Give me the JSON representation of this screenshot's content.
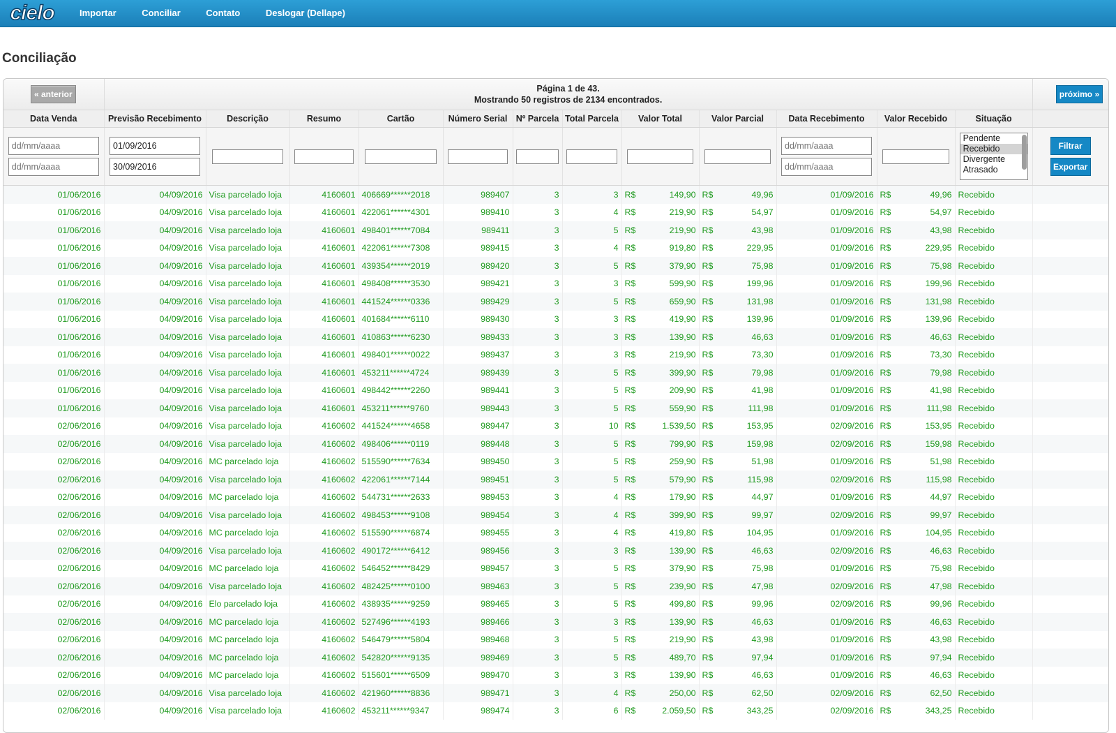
{
  "brand": {
    "logo_text": "cielo"
  },
  "nav": {
    "items": [
      "Importar",
      "Conciliar",
      "Contato",
      "Deslogar (Dellape)"
    ]
  },
  "page": {
    "title": "Conciliação"
  },
  "pager": {
    "prev_label": "« anterior",
    "next_label": "próximo »",
    "page_line": "Página 1 de 43.",
    "count_line": "Mostrando 50 registros de 2134 encontrados."
  },
  "columns": [
    "Data Venda",
    "Previsão Recebimento",
    "Descrição",
    "Resumo",
    "Cartão",
    "Número Serial",
    "Nº Parcela",
    "Total Parcela",
    "Valor Total",
    "Valor Parcial",
    "Data Recebimento",
    "Valor Recebido",
    "Situação",
    ""
  ],
  "filters": {
    "data_venda_from": {
      "value": "",
      "placeholder": "dd/mm/aaaa"
    },
    "data_venda_to": {
      "value": "",
      "placeholder": "dd/mm/aaaa"
    },
    "previsao_from": {
      "value": "01/09/2016",
      "placeholder": "dd/mm/aaaa"
    },
    "previsao_to": {
      "value": "30/09/2016",
      "placeholder": "dd/mm/aaaa"
    },
    "data_receb_from": {
      "value": "",
      "placeholder": "dd/mm/aaaa"
    },
    "data_receb_to": {
      "value": "",
      "placeholder": "dd/mm/aaaa"
    },
    "situacao_options": [
      "Pendente",
      "Recebido",
      "Divergente",
      "Atrasado"
    ],
    "situacao_selected": "Recebido",
    "filter_button": "Filtrar",
    "export_button": "Exportar"
  },
  "currency": "R$",
  "rows": [
    [
      "01/06/2016",
      "04/09/2016",
      "Visa parcelado loja",
      "4160601",
      "406669******2018",
      "989407",
      "3",
      "3",
      "149,90",
      "49,96",
      "01/09/2016",
      "49,96",
      "Recebido"
    ],
    [
      "01/06/2016",
      "04/09/2016",
      "Visa parcelado loja",
      "4160601",
      "422061******4301",
      "989410",
      "3",
      "4",
      "219,90",
      "54,97",
      "01/09/2016",
      "54,97",
      "Recebido"
    ],
    [
      "01/06/2016",
      "04/09/2016",
      "Visa parcelado loja",
      "4160601",
      "498401******7084",
      "989411",
      "3",
      "5",
      "219,90",
      "43,98",
      "01/09/2016",
      "43,98",
      "Recebido"
    ],
    [
      "01/06/2016",
      "04/09/2016",
      "Visa parcelado loja",
      "4160601",
      "422061******7308",
      "989415",
      "3",
      "4",
      "919,80",
      "229,95",
      "01/09/2016",
      "229,95",
      "Recebido"
    ],
    [
      "01/06/2016",
      "04/09/2016",
      "Visa parcelado loja",
      "4160601",
      "439354******2019",
      "989420",
      "3",
      "5",
      "379,90",
      "75,98",
      "01/09/2016",
      "75,98",
      "Recebido"
    ],
    [
      "01/06/2016",
      "04/09/2016",
      "Visa parcelado loja",
      "4160601",
      "498408******3530",
      "989421",
      "3",
      "3",
      "599,90",
      "199,96",
      "01/09/2016",
      "199,96",
      "Recebido"
    ],
    [
      "01/06/2016",
      "04/09/2016",
      "Visa parcelado loja",
      "4160601",
      "441524******0336",
      "989429",
      "3",
      "5",
      "659,90",
      "131,98",
      "01/09/2016",
      "131,98",
      "Recebido"
    ],
    [
      "01/06/2016",
      "04/09/2016",
      "Visa parcelado loja",
      "4160601",
      "401684******6110",
      "989430",
      "3",
      "3",
      "419,90",
      "139,96",
      "01/09/2016",
      "139,96",
      "Recebido"
    ],
    [
      "01/06/2016",
      "04/09/2016",
      "Visa parcelado loja",
      "4160601",
      "410863******6230",
      "989433",
      "3",
      "3",
      "139,90",
      "46,63",
      "01/09/2016",
      "46,63",
      "Recebido"
    ],
    [
      "01/06/2016",
      "04/09/2016",
      "Visa parcelado loja",
      "4160601",
      "498401******0022",
      "989437",
      "3",
      "3",
      "219,90",
      "73,30",
      "01/09/2016",
      "73,30",
      "Recebido"
    ],
    [
      "01/06/2016",
      "04/09/2016",
      "Visa parcelado loja",
      "4160601",
      "453211******4724",
      "989439",
      "3",
      "5",
      "399,90",
      "79,98",
      "01/09/2016",
      "79,98",
      "Recebido"
    ],
    [
      "01/06/2016",
      "04/09/2016",
      "Visa parcelado loja",
      "4160601",
      "498442******2260",
      "989441",
      "3",
      "5",
      "209,90",
      "41,98",
      "01/09/2016",
      "41,98",
      "Recebido"
    ],
    [
      "01/06/2016",
      "04/09/2016",
      "Visa parcelado loja",
      "4160601",
      "453211******9760",
      "989443",
      "3",
      "5",
      "559,90",
      "111,98",
      "01/09/2016",
      "111,98",
      "Recebido"
    ],
    [
      "02/06/2016",
      "04/09/2016",
      "Visa parcelado loja",
      "4160602",
      "441524******4658",
      "989447",
      "3",
      "10",
      "1.539,50",
      "153,95",
      "02/09/2016",
      "153,95",
      "Recebido"
    ],
    [
      "02/06/2016",
      "04/09/2016",
      "Visa parcelado loja",
      "4160602",
      "498406******0119",
      "989448",
      "3",
      "5",
      "799,90",
      "159,98",
      "02/09/2016",
      "159,98",
      "Recebido"
    ],
    [
      "02/06/2016",
      "04/09/2016",
      "MC parcelado loja",
      "4160602",
      "515590******7634",
      "989450",
      "3",
      "5",
      "259,90",
      "51,98",
      "01/09/2016",
      "51,98",
      "Recebido"
    ],
    [
      "02/06/2016",
      "04/09/2016",
      "Visa parcelado loja",
      "4160602",
      "422061******7144",
      "989451",
      "3",
      "5",
      "579,90",
      "115,98",
      "02/09/2016",
      "115,98",
      "Recebido"
    ],
    [
      "02/06/2016",
      "04/09/2016",
      "MC parcelado loja",
      "4160602",
      "544731******2633",
      "989453",
      "3",
      "4",
      "179,90",
      "44,97",
      "01/09/2016",
      "44,97",
      "Recebido"
    ],
    [
      "02/06/2016",
      "04/09/2016",
      "Visa parcelado loja",
      "4160602",
      "498453******9108",
      "989454",
      "3",
      "4",
      "399,90",
      "99,97",
      "02/09/2016",
      "99,97",
      "Recebido"
    ],
    [
      "02/06/2016",
      "04/09/2016",
      "MC parcelado loja",
      "4160602",
      "515590******6874",
      "989455",
      "3",
      "4",
      "419,80",
      "104,95",
      "01/09/2016",
      "104,95",
      "Recebido"
    ],
    [
      "02/06/2016",
      "04/09/2016",
      "Visa parcelado loja",
      "4160602",
      "490172******6412",
      "989456",
      "3",
      "3",
      "139,90",
      "46,63",
      "02/09/2016",
      "46,63",
      "Recebido"
    ],
    [
      "02/06/2016",
      "04/09/2016",
      "MC parcelado loja",
      "4160602",
      "546452******8429",
      "989457",
      "3",
      "5",
      "379,90",
      "75,98",
      "01/09/2016",
      "75,98",
      "Recebido"
    ],
    [
      "02/06/2016",
      "04/09/2016",
      "Visa parcelado loja",
      "4160602",
      "482425******0100",
      "989463",
      "3",
      "5",
      "239,90",
      "47,98",
      "02/09/2016",
      "47,98",
      "Recebido"
    ],
    [
      "02/06/2016",
      "04/09/2016",
      "Elo parcelado loja",
      "4160602",
      "438935******9259",
      "989465",
      "3",
      "5",
      "499,80",
      "99,96",
      "02/09/2016",
      "99,96",
      "Recebido"
    ],
    [
      "02/06/2016",
      "04/09/2016",
      "MC parcelado loja",
      "4160602",
      "527496******4193",
      "989466",
      "3",
      "3",
      "139,90",
      "46,63",
      "01/09/2016",
      "46,63",
      "Recebido"
    ],
    [
      "02/06/2016",
      "04/09/2016",
      "MC parcelado loja",
      "4160602",
      "546479******5804",
      "989468",
      "3",
      "5",
      "219,90",
      "43,98",
      "01/09/2016",
      "43,98",
      "Recebido"
    ],
    [
      "02/06/2016",
      "04/09/2016",
      "MC parcelado loja",
      "4160602",
      "542820******9135",
      "989469",
      "3",
      "5",
      "489,70",
      "97,94",
      "01/09/2016",
      "97,94",
      "Recebido"
    ],
    [
      "02/06/2016",
      "04/09/2016",
      "MC parcelado loja",
      "4160602",
      "515601******6509",
      "989470",
      "3",
      "3",
      "139,90",
      "46,63",
      "01/09/2016",
      "46,63",
      "Recebido"
    ],
    [
      "02/06/2016",
      "04/09/2016",
      "Visa parcelado loja",
      "4160602",
      "421960******8836",
      "989471",
      "3",
      "4",
      "250,00",
      "62,50",
      "02/09/2016",
      "62,50",
      "Recebido"
    ],
    [
      "02/06/2016",
      "04/09/2016",
      "Visa parcelado loja",
      "4160602",
      "453211******9347",
      "989474",
      "3",
      "6",
      "2.059,50",
      "343,25",
      "02/09/2016",
      "343,25",
      "Recebido"
    ]
  ],
  "colors": {
    "topbar": "#1b8fc8",
    "row_text": "#1f9a1f",
    "button": "#1588c5"
  }
}
